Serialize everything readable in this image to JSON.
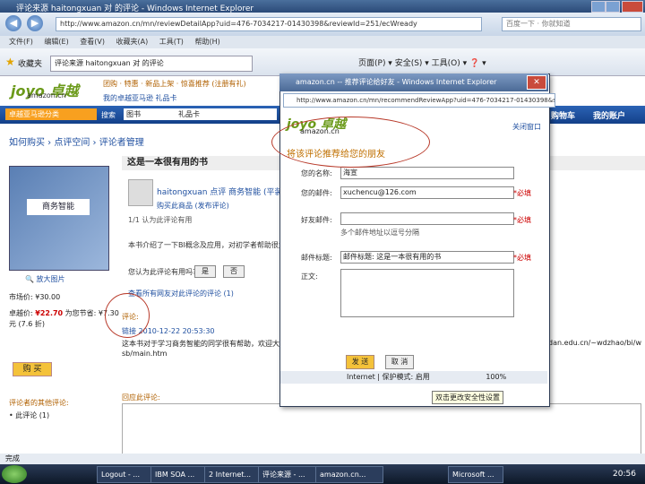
{
  "window": {
    "title": "评论来源 haitongxuan 对 的评论 - Windows Internet Explorer"
  },
  "address_bar": {
    "url": "http://www.amazon.cn/mn/reviewDetailApp?uid=476-7034217-01430398&reviewId=251/ecWready",
    "search_placeholder": "百度一下 · 你就知道"
  },
  "menu": [
    "文件(F)",
    "编辑(E)",
    "查看(V)",
    "收藏夹(A)",
    "工具(T)",
    "帮助(H)"
  ],
  "favorites": {
    "label": "收藏夹",
    "tab_title": "评论来源 haitongxuan 对 的评论",
    "commands": "页面(P) ▾   安全(S) ▾   工具(O) ▾   ❓ ▾"
  },
  "page": {
    "logo": "joyo 卓越",
    "logo_sub": "amazon.cn",
    "promo": "团购 · 特惠 · 新品上架 · 惊喜推荐 (注册有礼)",
    "promo2": "我的卓越亚马逊   礼品卡",
    "category": "卓越亚马逊分类",
    "search_label": "搜索",
    "search_scope": "图书",
    "search_value": "礼品卡",
    "cart": "购物车",
    "account": "我的账户",
    "breadcrumb": "如何购买 › 点评空间 › 评论者管理",
    "book_title": "商务智能",
    "zoom": "🔍 放大图片",
    "list_price": "市场价: ¥30.00",
    "our_price_label": "卓越价:",
    "our_price": "¥22.70",
    "our_price_suffix": "为您节省: ¥7.30",
    "saves": "元 (7.6 折)",
    "buy": "购 买",
    "section_head": "这是一本很有用的书",
    "reviewer": "haitongxuan 点评 商务智能 (平装) 到",
    "buy_sub": "购买此商品 (发布评论)",
    "helpful": "1/1 认为此评论有用",
    "review_text": "本书介绍了一下BI概念及应用，对初学者帮助很大，值得推荐。",
    "helpful_q": "您认为此评论有用吗?",
    "yes": "是",
    "no": "否",
    "comments_link": "查看所有网友对此评论的评论 (1)",
    "comment_label": "评论:",
    "comment_meta": "链接 2010-12-22 20:53:30",
    "comment_line1": "这本书对于学习商务智能的同学很有帮助，欢迎大家访问学习网站",
    "comment_line2": "sb/main.htm",
    "url_frag": "dan.edu.cn/~wdzhao/bi/w",
    "reply_label": "回应此评论:",
    "reviews_label": "评论者的其他评论:",
    "reviews_item": "• 此评论 (1)",
    "status": "完成"
  },
  "popup": {
    "title": "amazon.cn -- 推荐评论给好友 - Windows Internet Explorer",
    "url": "http://www.amazon.cn/mn/recommendReviewApp?uid=476-7034217-01430398&subj",
    "logo": "joyo 卓越",
    "logo_sub": "amazon.cn",
    "close_link": "关闭窗口",
    "heading": "将该评论推荐给您的朋友",
    "labels": {
      "name": "您的名称:",
      "email": "您的邮件:",
      "friend": "好友邮件:",
      "subject": "邮件标题:",
      "body": "正文:"
    },
    "values": {
      "name": "海宣",
      "email": "xuchencu@126.com",
      "friend": "",
      "subject": "邮件标题: 这是一本很有用的书",
      "body": ""
    },
    "required": "*必填",
    "hint": "多个邮件地址以逗号分隔",
    "send": "发 送",
    "cancel": "取 消",
    "status": "Internet | 保护模式: 启用",
    "zoom": "100%",
    "tooltip": "双击更改安全性设置"
  },
  "taskbar": {
    "items": [
      "Logout - ...",
      "IBM SOA ...",
      "2 Internet...",
      "评论来源 - ...",
      "amazon.cn...",
      "Microsoft ..."
    ],
    "clock": "20:56"
  }
}
